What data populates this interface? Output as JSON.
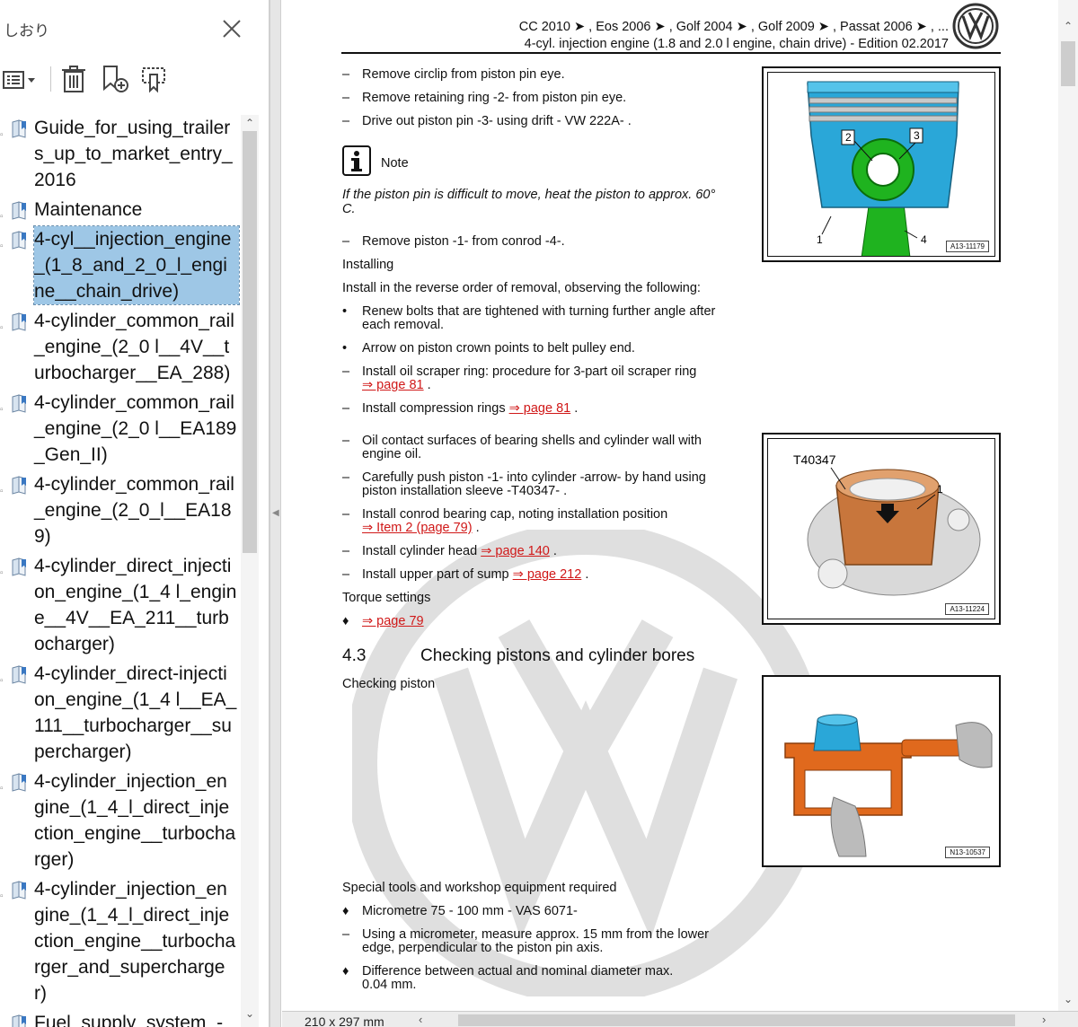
{
  "panel": {
    "title": "しおり",
    "items": [
      {
        "label": "Guide_for_using_trailers_up_to_market_entry_2016",
        "selected": false
      },
      {
        "label": "Maintenance",
        "selected": false
      },
      {
        "label": "4-cyl__injection_engine_(1_8_and_2_0_l_engine__chain_drive)",
        "selected": true
      },
      {
        "label": "4-cylinder_common_rail_engine_(2_0 l__4V__turbocharger__EA_288)",
        "selected": false
      },
      {
        "label": "4-cylinder_common_rail_engine_(2_0 l__EA189_Gen_II)",
        "selected": false
      },
      {
        "label": "4-cylinder_common_rail_engine_(2_0_l__EA189)",
        "selected": false
      },
      {
        "label": "4-cylinder_direct_injection_engine_(1_4 l_engine__4V__EA_211__turbocharger)",
        "selected": false
      },
      {
        "label": "4-cylinder_direct-injection_engine_(1_4 l__EA_111__turbocharger__supercharger)",
        "selected": false
      },
      {
        "label": "4-cylinder_injection_engine_(1_4_l_direct_injection_engine__turbocharger)",
        "selected": false
      },
      {
        "label": "4-cylinder_injection_engine_(1_4_l_direct_injection_engine__turbocharger_and_supercharger)",
        "selected": false
      },
      {
        "label": "Fuel_supply_system_-_Diesel_engines",
        "selected": false
      }
    ]
  },
  "doc": {
    "header_line1": "CC 2010 ➤ , Eos 2006 ➤ , Golf 2004 ➤ , Golf 2009 ➤ , Passat 2006 ➤ , ...",
    "header_line2": "4-cyl. injection engine (1.8 and 2.0 l engine, chain drive) - Edition 02.2017",
    "lines": [
      {
        "b": "–",
        "t": "Remove circlip from piston pin eye."
      },
      {
        "b": "–",
        "t": "Remove retaining ring -2- from piston pin eye."
      },
      {
        "b": "–",
        "t": "Drive out piston pin -3- using drift - VW 222A- ."
      },
      {
        "b": "–",
        "t": "Remove piston -1- from conrod -4-."
      },
      {
        "b": "–",
        "t": "Oil contact surfaces of bearing shells and cylinder wall with",
        "t2": "engine oil."
      },
      {
        "b": "–",
        "t": "Carefully push piston -1- into cylinder -arrow- by hand using",
        "t2": "piston installation sleeve -T40347- ."
      },
      {
        "b": "–",
        "t": "Using a micrometer, measure approx. 15 mm from the lower",
        "t2": "edge, perpendicular to the piston pin axis."
      }
    ],
    "note_label": "Note",
    "note_text_1": "If the piston pin is difficult to move, heat the piston to approx. 60°",
    "note_text_2": "C.",
    "installing": "Installing",
    "install_intro": "Install in the reverse order of removal, observing the following:",
    "bullet1_1": "Renew bolts that are tightened with turning further angle after",
    "bullet1_2": "each removal.",
    "bullet2": "Arrow on piston crown points to belt pulley end.",
    "oil_ring_1": "Install oil scraper ring: procedure for 3-part oil scraper ring",
    "link_page81": "⇒ page 81",
    "comp_rings": "Install compression rings",
    "conrod_cap": "Install conrod bearing cap, noting installation position",
    "link_item2": "⇒ Item 2 (page 79)",
    "cyl_head": "Install cylinder head",
    "link_page140": "⇒ page 140",
    "sump": "Install upper part of sump",
    "link_page212": "⇒ page 212",
    "torque": "Torque settings",
    "link_page79": "⇒ page 79",
    "section_number": "4.3",
    "section_title": "Checking pistons and cylinder bores",
    "checking_piston": "Checking piston",
    "special_tools": "Special tools and workshop equipment required",
    "micrometer": "Micrometre 75 - 100 mm - VAS 6071-",
    "difference_1": "Difference between actual and nominal diameter max.",
    "difference_2": "0.04 mm.",
    "fig1_code": "A13-11179",
    "fig1_labels": [
      "1",
      "2",
      "3",
      "4"
    ],
    "fig2_tool": "T40347",
    "fig2_label": "1",
    "fig2_code": "A13-11224",
    "fig3_code": "N13-10537"
  },
  "status": {
    "page_size": "210 x 297 mm"
  },
  "colors": {
    "selection": "#9ec7e6",
    "link": "#d01818",
    "piston_blue": "#2aa7d8",
    "conrod_green": "#1fb31f",
    "sleeve_copper": "#c8763c",
    "micrometer_orange": "#e0691d"
  }
}
